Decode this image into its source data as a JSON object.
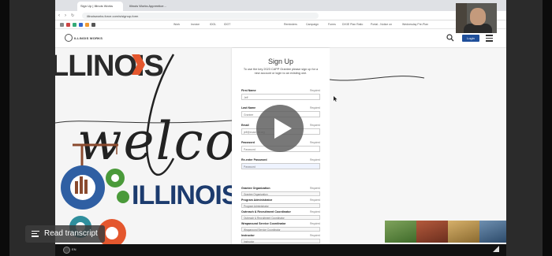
{
  "browser": {
    "tabs": [
      {
        "label": "Sign Up | Illinois Works"
      },
      {
        "label": "Illinois Works Apprentice..."
      }
    ],
    "address": "illinoisworks.force.com/s/signup-form",
    "bookmarks": [
      "Work",
      "Invoice",
      "IDOL",
      "IDOT",
      "Reminders",
      "Campaign",
      "Forms",
      "DIXIE Plan Ratio",
      "Portal - Notice on",
      "Wednesday Pre-Plan"
    ]
  },
  "site": {
    "logo_text": "ILLINOIS WORKS",
    "login_label": "Login"
  },
  "hero": {
    "illinois_top": "LLINOIS",
    "welcome": "welco",
    "illinois_bottom": "ILLINOIS"
  },
  "signup": {
    "title": "Sign Up",
    "description": "To use the key 2023 CAPP Grantee please sign up for a new account or login to an existing one.",
    "required_label": "Required",
    "fields": [
      {
        "label": "First Name",
        "value": "Jeff"
      },
      {
        "label": "Last Name",
        "value": "Grantee"
      },
      {
        "label": "Email",
        "value": "jeff@example.org"
      },
      {
        "label": "Password",
        "value": "Password"
      },
      {
        "label": "Re-enter Password",
        "value": "Password"
      }
    ],
    "select_fields": [
      {
        "label": "Grantee Organization",
        "value": "Grantee Organization"
      },
      {
        "label": "Program Administrator",
        "value": "Program Administrator"
      },
      {
        "label": "Outreach & Recruitment Coordinator",
        "value": "Outreach & Recruitment Coordinator"
      },
      {
        "label": "Wraparound Service Coordinator",
        "value": "Wraparound Service Coordinator"
      },
      {
        "label": "Instructor",
        "value": "Instructor"
      }
    ]
  },
  "player": {
    "transcript_label": "Read transcript",
    "language": "EN"
  },
  "colors": {
    "brand_blue": "#1f4f9a",
    "illinois_blue": "#1c3b6e",
    "accent_orange": "#e4572e",
    "gear_teal": "#2f8f9d",
    "gear_green": "#4a9a3a"
  }
}
